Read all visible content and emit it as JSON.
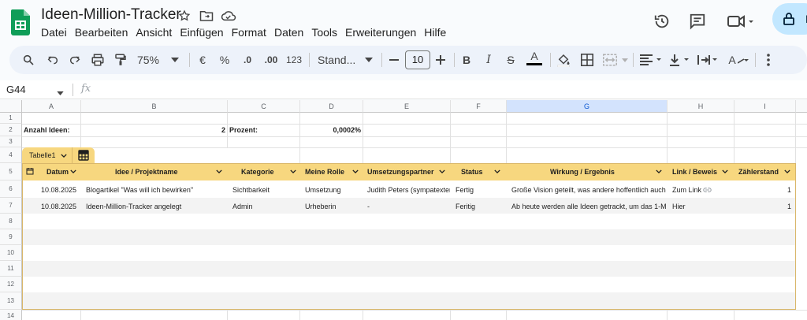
{
  "app": {
    "title": "Ideen-Million-Tracker",
    "share_label": "F"
  },
  "menu": [
    "Datei",
    "Bearbeiten",
    "Ansicht",
    "Einfügen",
    "Format",
    "Daten",
    "Tools",
    "Erweiterungen",
    "Hilfe"
  ],
  "toolbar": {
    "zoom": "75%",
    "currency": "€",
    "percent": "%",
    "decrease_decimal": ".0",
    "increase_decimal": ".00",
    "number_format": "123",
    "font": "Stand...",
    "font_size": "10",
    "bold": "B",
    "italic": "I",
    "strike": "S",
    "text_color": "A",
    "rotate": "A"
  },
  "formula_bar": {
    "cell_ref": "G44",
    "fx": "fx",
    "value": ""
  },
  "columns": [
    "A",
    "B",
    "C",
    "D",
    "E",
    "F",
    "G",
    "H",
    "I"
  ],
  "selected_column": "G",
  "rows": [
    "1",
    "2",
    "3",
    "4",
    "5",
    "6",
    "7",
    "8",
    "9",
    "10",
    "11",
    "12",
    "13",
    "14"
  ],
  "summary": {
    "count_label": "Anzahl Ideen:",
    "count_value": "2",
    "percent_label": "Prozent:",
    "percent_value": "0,0002%"
  },
  "table": {
    "name": "Tabelle1",
    "headers": [
      "Datum",
      "Idee / Projektname",
      "Kategorie",
      "Meine Rolle",
      "Umsetzungspartner",
      "Status",
      "Wirkung / Ergebnis",
      "Link / Beweis",
      "Zählerstand"
    ],
    "rows": [
      {
        "datum": "10.08.2025",
        "idee": "Blogartikel \"Was will ich bewirken\"",
        "kategorie": "Sichtbarkeit",
        "rolle": "Umsetzung",
        "partner": "Judith Peters (sympatexter",
        "status": "Fertig",
        "wirkung": "Große Vision geteilt, was andere hoffentlich auch",
        "link": "Zum Link",
        "zaehler": "1"
      },
      {
        "datum": "10.08.2025",
        "idee": "Ideen-Million-Tracker angelegt",
        "kategorie": "Admin",
        "rolle": "Urheberin",
        "partner": "-",
        "status": "Feritig",
        "wirkung": "Ab heute werden alle Ideen getrackt, um das 1-M",
        "link": "Hier",
        "zaehler": "1"
      }
    ]
  }
}
